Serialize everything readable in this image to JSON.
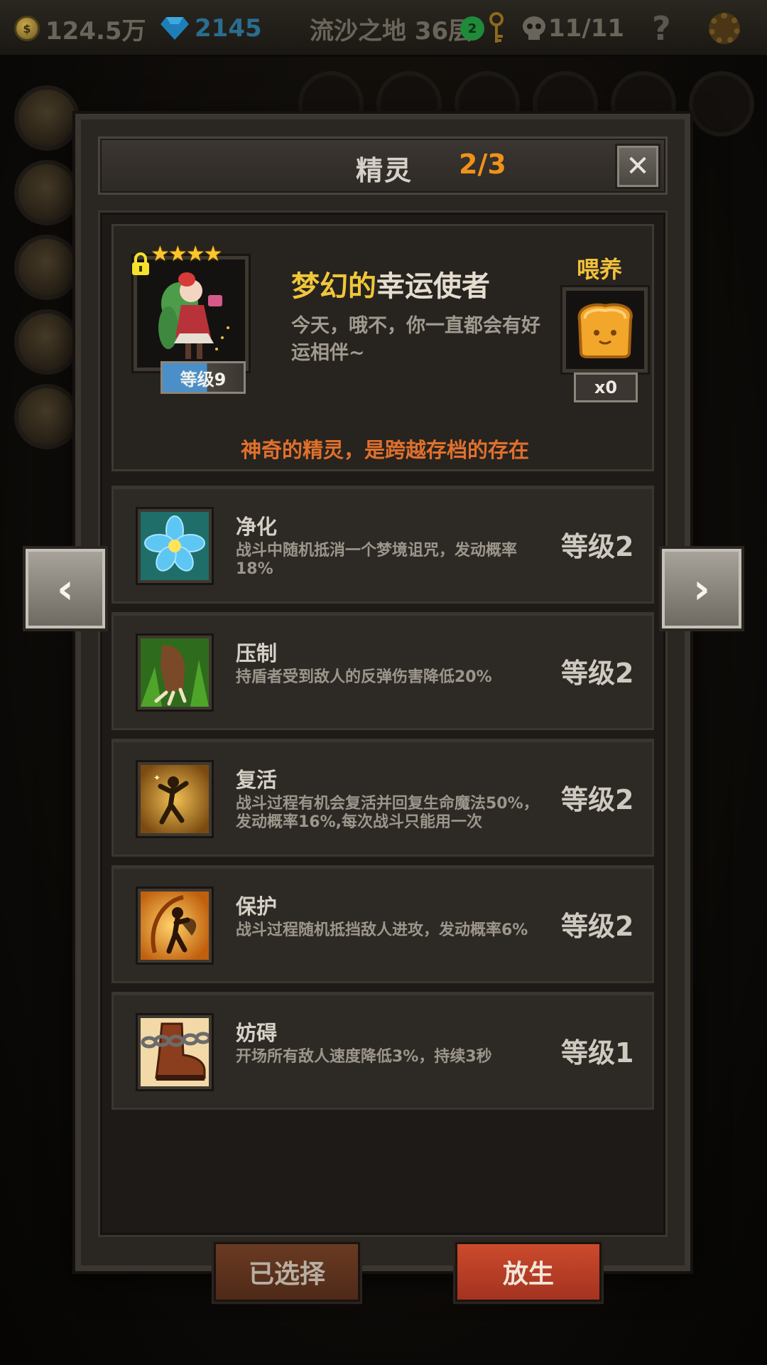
{
  "topbar": {
    "gold": "124.5万",
    "gems": "2145",
    "location": "流沙之地 36层",
    "keys_badge": "2",
    "kills": "11/11",
    "help": "?"
  },
  "dialog": {
    "title": "精灵",
    "counter": "2/3",
    "close": "✕"
  },
  "pet": {
    "stars": "★★★★",
    "level": "等级9",
    "level_progress": 0.55,
    "name_prefix": "梦幻的",
    "name_base": "幸运使者",
    "description": "今天，哦不，你一直都会有好运相伴~",
    "feed_label": "喂养",
    "feed_count": "x0",
    "tagline": "神奇的精灵，是跨越存档的存在"
  },
  "skills": [
    {
      "name": "净化",
      "desc": "战斗中随机抵消一个梦境诅咒，发动概率18%",
      "level": "等级2",
      "icon": "blue-flower-icon"
    },
    {
      "name": "压制",
      "desc": "持盾者受到敌人的反弹伤害降低20%",
      "level": "等级2",
      "icon": "claw-icon"
    },
    {
      "name": "复活",
      "desc": "战斗过程有机会复活并回复生命魔法50%，发动概率16%,每次战斗只能用一次",
      "level": "等级2",
      "icon": "revive-figure-icon"
    },
    {
      "name": "保护",
      "desc": "战斗过程随机抵挡敌人进攻，发动概率6%",
      "level": "等级2",
      "icon": "fairy-shield-icon"
    },
    {
      "name": "妨碍",
      "desc": "开场所有敌人速度降低3%，持续3秒",
      "level": "等级1",
      "icon": "chained-boot-icon"
    }
  ],
  "buttons": {
    "selected": "已选择",
    "release": "放生"
  },
  "nav": {
    "prev": "‹",
    "next": "›"
  },
  "colors": {
    "accent_orange": "#f0921a",
    "name_gold": "#f0c63a",
    "tagline": "#e0702c",
    "release_red": "#cc4a2c"
  }
}
